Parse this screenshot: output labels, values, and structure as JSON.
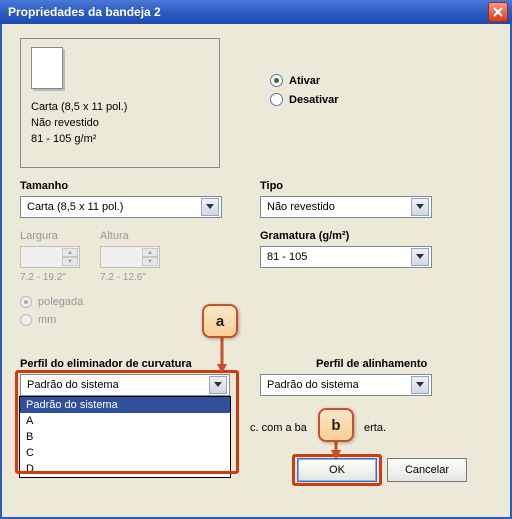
{
  "window": {
    "title": "Propriedades da bandeja 2"
  },
  "preview": {
    "paper": "Carta (8,5 x 11 pol.)",
    "coating": "Não revestido",
    "weight": "81 - 105 g/m²"
  },
  "activate": {
    "on_label": "Ativar",
    "off_label": "Desativar",
    "value": "on"
  },
  "size": {
    "label": "Tamanho",
    "value": "Carta (8,5 x 11 pol.)"
  },
  "type": {
    "label": "Tipo",
    "value": "Não revestido"
  },
  "width": {
    "label": "Largura",
    "hint": "7.2 - 19.2\""
  },
  "height": {
    "label": "Altura",
    "hint": "7.2 - 12.6\""
  },
  "weight": {
    "label": "Gramatura (g/m²)",
    "value": "81 - 105"
  },
  "units": {
    "inch": "polegada",
    "mm": "mm",
    "selected": "inch"
  },
  "decurler": {
    "label": "Perfil do eliminador de curvatura",
    "value": "Padrão do sistema",
    "options": [
      "Padrão do sistema",
      "A",
      "B",
      "C",
      "D"
    ]
  },
  "alignment": {
    "label": "Perfil de alinhamento",
    "value": "Padrão do sistema"
  },
  "hint_fragment_left": "c. com a ba",
  "hint_fragment_right": "erta.",
  "buttons": {
    "ok": "OK",
    "cancel": "Cancelar"
  },
  "callouts": {
    "a": "a",
    "b": "b"
  }
}
